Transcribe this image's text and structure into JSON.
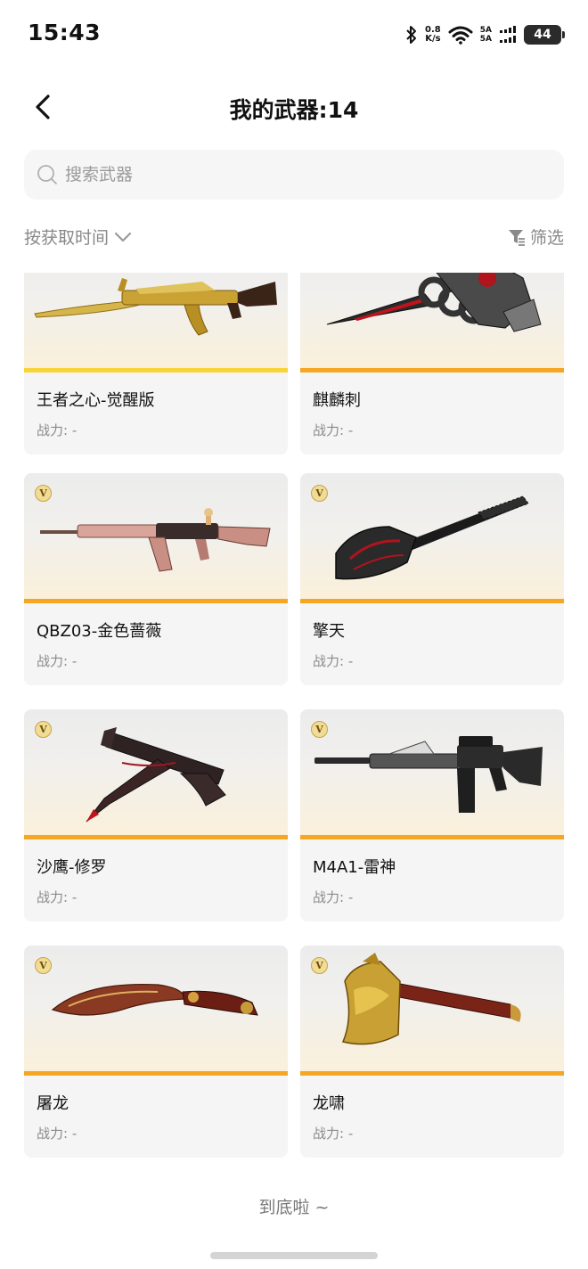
{
  "status_bar": {
    "time": "15:43",
    "net_speed_value": "0.8",
    "net_speed_unit": "K/s",
    "sim1": "5A",
    "sim2": "5A",
    "battery": "44"
  },
  "header": {
    "title": "我的武器:14",
    "back_icon": "chevron-left-icon"
  },
  "search": {
    "placeholder": "搜索武器",
    "value": "",
    "icon": "search-icon"
  },
  "toolbar": {
    "sort_label": "按获取时间",
    "sort_icon": "chevron-down-icon",
    "filter_label": "筛选",
    "filter_icon": "filter-icon"
  },
  "weapons": [
    {
      "name": "王者之心-觉醒版",
      "power": "战力: -",
      "badge": "",
      "stripe_color": "#f6d43a"
    },
    {
      "name": "麒麟刺",
      "power": "战力: -",
      "badge": "",
      "stripe_color": "#f5a623"
    },
    {
      "name": "QBZ03-金色蔷薇",
      "power": "战力: -",
      "badge": "V",
      "stripe_color": "#f5a623"
    },
    {
      "name": "擎天",
      "power": "战力: -",
      "badge": "V",
      "stripe_color": "#f5a623"
    },
    {
      "name": "沙鹰-修罗",
      "power": "战力: -",
      "badge": "V",
      "stripe_color": "#f5a623"
    },
    {
      "name": "M4A1-雷神",
      "power": "战力: -",
      "badge": "V",
      "stripe_color": "#f5a623"
    },
    {
      "name": "屠龙",
      "power": "战力: -",
      "badge": "V",
      "stripe_color": "#f5a623"
    },
    {
      "name": "龙啸",
      "power": "战力: -",
      "badge": "V",
      "stripe_color": "#f5a623"
    }
  ],
  "footer": {
    "end_text": "到底啦 ~"
  }
}
